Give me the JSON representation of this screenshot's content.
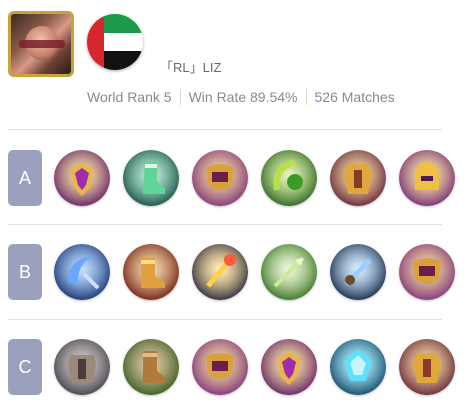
{
  "player": {
    "name": "「RL」LIZ",
    "flag": {
      "hoist": "#d7262e",
      "bands": [
        "#1a9a4a",
        "#ffffff",
        "#111111"
      ]
    }
  },
  "stats": {
    "world_rank": "World Rank 5",
    "win_rate": "Win Rate 89.54%",
    "matches": "526 Matches"
  },
  "tiers": [
    {
      "label": "A",
      "items": [
        {
          "icon": "purple-gold-crest",
          "bg": "#5a1466",
          "accent": "#e8b74a"
        },
        {
          "icon": "green-boots",
          "bg": "#124440",
          "accent": "#5fd39a"
        },
        {
          "icon": "golden-shield",
          "bg": "#7a2a7e",
          "accent": "#d9a13a"
        },
        {
          "icon": "green-serpent-bow",
          "bg": "#1f5a1f",
          "accent": "#b8e04a"
        },
        {
          "icon": "golden-armor",
          "bg": "#5c1a3a",
          "accent": "#e0a83a"
        },
        {
          "icon": "golden-helm",
          "bg": "#6a1f7a",
          "accent": "#f0c040"
        }
      ]
    },
    {
      "label": "B",
      "items": [
        {
          "icon": "blue-crescent-blade",
          "bg": "#0d2a66",
          "accent": "#6aa8ff"
        },
        {
          "icon": "red-gold-boots",
          "bg": "#6a1410",
          "accent": "#e0a040"
        },
        {
          "icon": "golden-scepter",
          "bg": "#1a1a3a",
          "accent": "#ffd04a"
        },
        {
          "icon": "green-spear",
          "bg": "#2a6a1a",
          "accent": "#cfe89a"
        },
        {
          "icon": "frost-dagger",
          "bg": "#0b1b3a",
          "accent": "#9ad0ff"
        },
        {
          "icon": "golden-shield",
          "bg": "#7a2a7e",
          "accent": "#d9a13a"
        }
      ]
    },
    {
      "label": "C",
      "items": [
        {
          "icon": "dark-iron-armor",
          "bg": "#3a3a4a",
          "accent": "#9a8a7a"
        },
        {
          "icon": "leather-boots",
          "bg": "#2a5a1a",
          "accent": "#b07a3a"
        },
        {
          "icon": "golden-shield",
          "bg": "#7a2a7e",
          "accent": "#d9a13a"
        },
        {
          "icon": "purple-gold-crest",
          "bg": "#5a1466",
          "accent": "#e8b74a"
        },
        {
          "icon": "cyan-crystal",
          "bg": "#0a3a5a",
          "accent": "#5fe0ff"
        },
        {
          "icon": "golden-armor",
          "bg": "#5c1a3a",
          "accent": "#e0a83a"
        }
      ]
    }
  ]
}
